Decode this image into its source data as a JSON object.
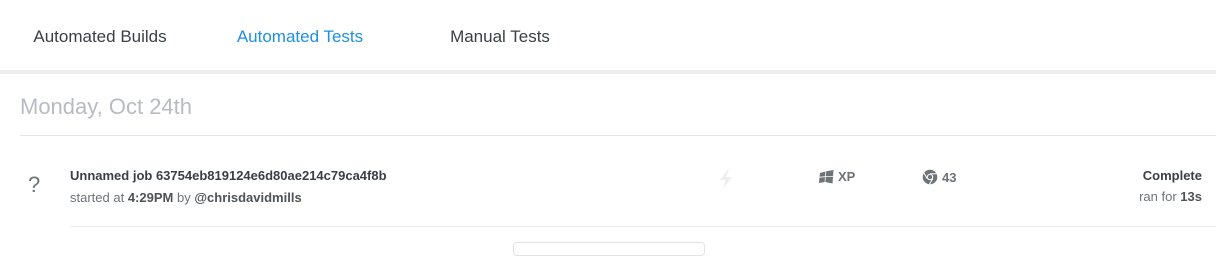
{
  "tabs": [
    {
      "label": "Automated Builds"
    },
    {
      "label": "Automated Tests"
    },
    {
      "label": "Manual Tests"
    }
  ],
  "day": {
    "heading": "Monday, Oct 24th"
  },
  "job": {
    "status_symbol": "?",
    "name": "Unnamed job 63754eb819124e6d80ae214c79ca4f8b",
    "started_prefix": "started at",
    "started_time": "4:29PM",
    "by_label": "by",
    "user": "@chrisdavidmills",
    "os": "XP",
    "browser_version": "43",
    "status": "Complete",
    "ran_for_label": "ran for",
    "duration": "13s"
  },
  "colors": {
    "accent": "#1e90e0",
    "muted_heading": "#b8bcc2"
  },
  "icons": {
    "bolt": "lightning-bolt-icon",
    "os": "windows-icon",
    "browser": "chrome-icon"
  }
}
